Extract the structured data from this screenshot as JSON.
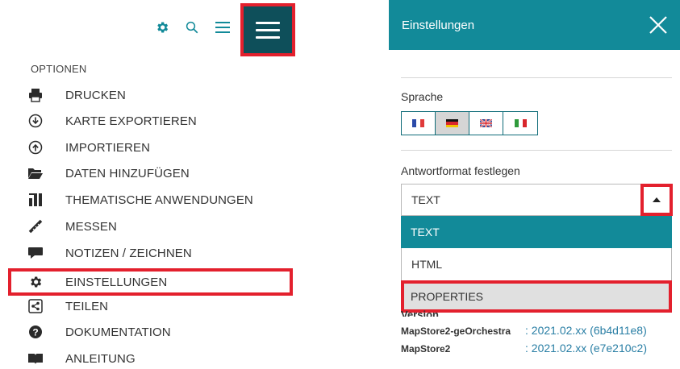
{
  "toolbar": {
    "icons": [
      "gear-icon",
      "search-icon",
      "list-icon",
      "hamburger-icon"
    ],
    "accent": "#0e4f5a"
  },
  "menu": {
    "header": "OPTIONEN",
    "items": [
      {
        "label": "DRUCKEN",
        "icon": "print-icon"
      },
      {
        "label": "KARTE EXPORTIEREN",
        "icon": "export-icon"
      },
      {
        "label": "IMPORTIEREN",
        "icon": "import-icon"
      },
      {
        "label": "DATEN HINZUFÜGEN",
        "icon": "folder-icon"
      },
      {
        "label": "THEMATISCHE ANWENDUNGEN",
        "icon": "thematic-icon"
      },
      {
        "label": "MESSEN",
        "icon": "ruler-icon"
      },
      {
        "label": "NOTIZEN / ZEICHNEN",
        "icon": "comment-icon"
      },
      {
        "label": "EINSTELLUNGEN",
        "icon": "gear-icon",
        "highlighted": true
      },
      {
        "label": "TEILEN",
        "icon": "share-icon"
      },
      {
        "label": "DOKUMENTATION",
        "icon": "question-icon"
      },
      {
        "label": "ANLEITUNG",
        "icon": "book-icon"
      }
    ]
  },
  "settings": {
    "title": "Einstellungen",
    "header_color": "#128a99",
    "language_label": "Sprache",
    "languages": [
      {
        "name": "fr",
        "active": false
      },
      {
        "name": "de",
        "active": true
      },
      {
        "name": "en",
        "active": false
      },
      {
        "name": "it",
        "active": false
      }
    ],
    "format_label": "Antwortformat festlegen",
    "format_value": "TEXT",
    "format_options": [
      "TEXT",
      "HTML",
      "PROPERTIES"
    ],
    "version_label": "Version",
    "versions": [
      {
        "name": "MapStore2-geOrchestra",
        "value": ": 2021.02.xx (6b4d11e8)"
      },
      {
        "name": "MapStore2",
        "value": ": 2021.02.xx (e7e210c2)"
      }
    ]
  },
  "highlight_color": "#e3202d"
}
